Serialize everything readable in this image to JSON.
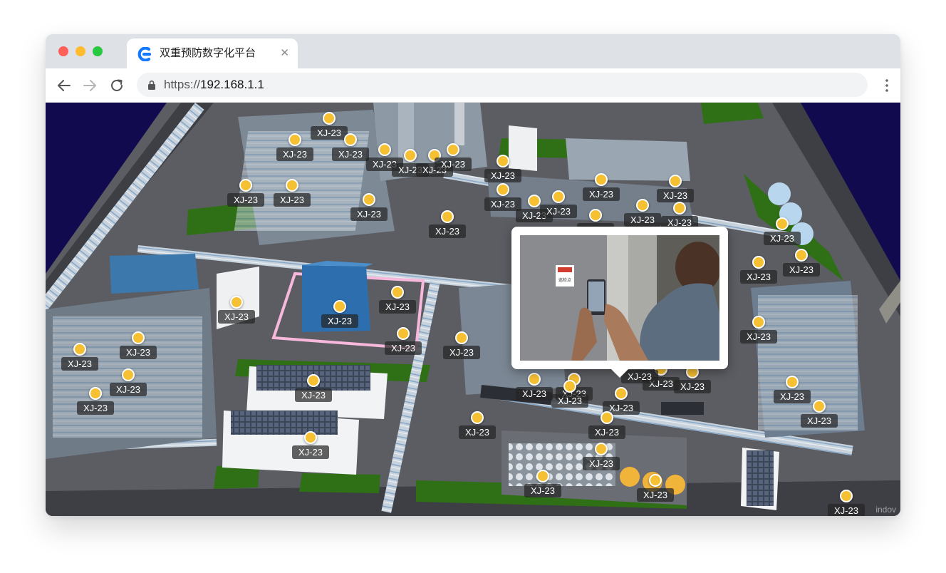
{
  "browser": {
    "tab_title": "双重预防数字化平台",
    "tab_close": "✕",
    "url_scheme": "https://",
    "url_host": "192.168.1.1"
  },
  "icons": {
    "tab_logo": "platform-logo-icon",
    "back": "arrow-left-icon",
    "forward": "arrow-right-icon",
    "reload": "reload-icon",
    "secure": "lock-icon",
    "menu": "vertical-dots-icon",
    "marker": "map-pin-dot-icon"
  },
  "colors": {
    "marker_fill": "#f6c033",
    "label_bg": "#262626",
    "ground": "#5b5d63",
    "grass": "#2f6f16",
    "building_blue": "#2d6fae",
    "sky": "#120a4e"
  },
  "markers": [
    {
      "label": "XJ-23"
    },
    {
      "label": "XJ-23"
    },
    {
      "label": "XJ-23"
    },
    {
      "label": "XJ-23"
    },
    {
      "label": "XJ-23"
    },
    {
      "label": "XJ-23"
    },
    {
      "label": "XJ-23"
    },
    {
      "label": "XJ-23"
    },
    {
      "label": "XJ-23"
    },
    {
      "label": "XJ-23"
    },
    {
      "label": "XJ-23"
    },
    {
      "label": "XJ-23"
    },
    {
      "label": "XJ-23"
    },
    {
      "label": "XJ-23"
    },
    {
      "label": "XJ-23"
    },
    {
      "label": "XJ-23"
    },
    {
      "label": "XJ-23"
    },
    {
      "label": "XJ-23"
    },
    {
      "label": "XJ-23"
    },
    {
      "label": "XJ-23"
    },
    {
      "label": "XJ-23"
    },
    {
      "label": "XJ-23"
    },
    {
      "label": "XJ-23"
    },
    {
      "label": "XJ-23"
    },
    {
      "label": "XJ-23"
    },
    {
      "label": "XJ-23"
    },
    {
      "label": "XJ-23"
    },
    {
      "label": "XJ-23"
    },
    {
      "label": "XJ-23"
    },
    {
      "label": "XJ-23"
    },
    {
      "label": "XJ-23"
    },
    {
      "label": "XJ-23"
    },
    {
      "label": "XJ-23"
    },
    {
      "label": "XJ-23"
    },
    {
      "label": "XJ-23"
    },
    {
      "label": "XJ-23"
    },
    {
      "label": "XJ-23"
    },
    {
      "label": "XJ-23"
    },
    {
      "label": "XJ-23"
    },
    {
      "label": "XJ-23"
    },
    {
      "label": "XJ-23"
    },
    {
      "label": "XJ-23"
    },
    {
      "label": "XJ-23"
    },
    {
      "label": "XJ-23"
    },
    {
      "label": "XJ-23"
    },
    {
      "label": "XJ-23"
    },
    {
      "label": "XJ-23"
    },
    {
      "label": "XJ-23"
    },
    {
      "label": "XJ-23"
    },
    {
      "label": "XJ-23"
    }
  ],
  "popup": {
    "photo_sign_text": "巡检点"
  },
  "watermark": "indov"
}
